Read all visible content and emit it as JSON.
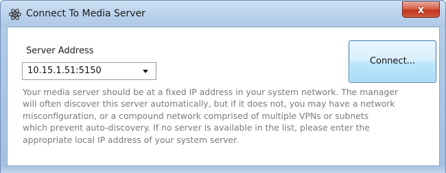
{
  "window": {
    "title": "Connect To Media Server",
    "icon": "atom-app-icon",
    "close_label": "x"
  },
  "form": {
    "server_address_label": "Server Address",
    "server_address_value": "10.15.1.51:5150",
    "connect_label": "Connect..."
  },
  "help_lines": [
    "Your media server should be at a fixed IP address in your system network. The manager",
    "will often discover this server automatically, but if it does not, you may have a network",
    "misconfiguration, or a compound network comprised of multiple VPNs or subnets",
    "which prevent auto-discovery. If no server is available in the list, please enter the",
    "appropriate local IP address of your system server."
  ],
  "colors": {
    "close_button": "#c2361d",
    "connect_border": "#3c7fb1",
    "help_text": "#7a7a7a"
  }
}
